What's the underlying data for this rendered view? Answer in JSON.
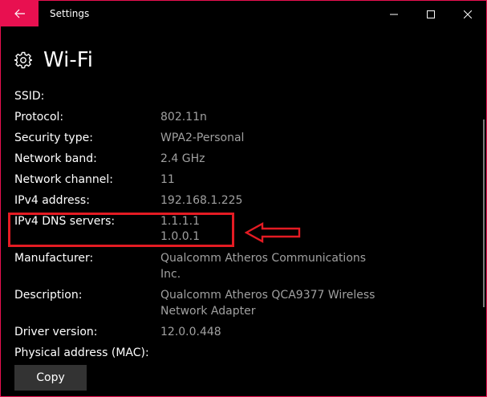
{
  "titlebar": {
    "title": "Settings",
    "back_icon": "back-arrow-icon",
    "minimize_icon": "minimize-icon",
    "maximize_icon": "maximize-icon",
    "close_icon": "close-icon",
    "accent_color": "#e81050"
  },
  "header": {
    "icon": "gear-icon",
    "title": "Wi-Fi"
  },
  "properties": [
    {
      "label": "SSID:",
      "value": ""
    },
    {
      "label": "Protocol:",
      "value": "802.11n"
    },
    {
      "label": "Security type:",
      "value": "WPA2-Personal"
    },
    {
      "label": "Network band:",
      "value": "2.4 GHz"
    },
    {
      "label": "Network channel:",
      "value": "11"
    },
    {
      "label": "IPv4 address:",
      "value": "192.168.1.225"
    },
    {
      "label": "IPv4 DNS servers:",
      "value_lines": [
        "1.1.1.1",
        "1.0.0.1"
      ]
    },
    {
      "label": "Manufacturer:",
      "value_lines": [
        "Qualcomm Atheros Communications",
        "Inc."
      ]
    },
    {
      "label": "Description:",
      "value_lines": [
        "Qualcomm Atheros QCA9377 Wireless",
        "Network Adapter"
      ]
    },
    {
      "label": "Driver version:",
      "value": "12.0.0.448"
    },
    {
      "label": "Physical address (MAC):",
      "value": ""
    }
  ],
  "copy_button": {
    "label": "Copy"
  },
  "annotation": {
    "color": "#e41b23",
    "highlight": "IPv4 DNS servers",
    "arrow_icon": "left-arrow-annotation-icon"
  }
}
